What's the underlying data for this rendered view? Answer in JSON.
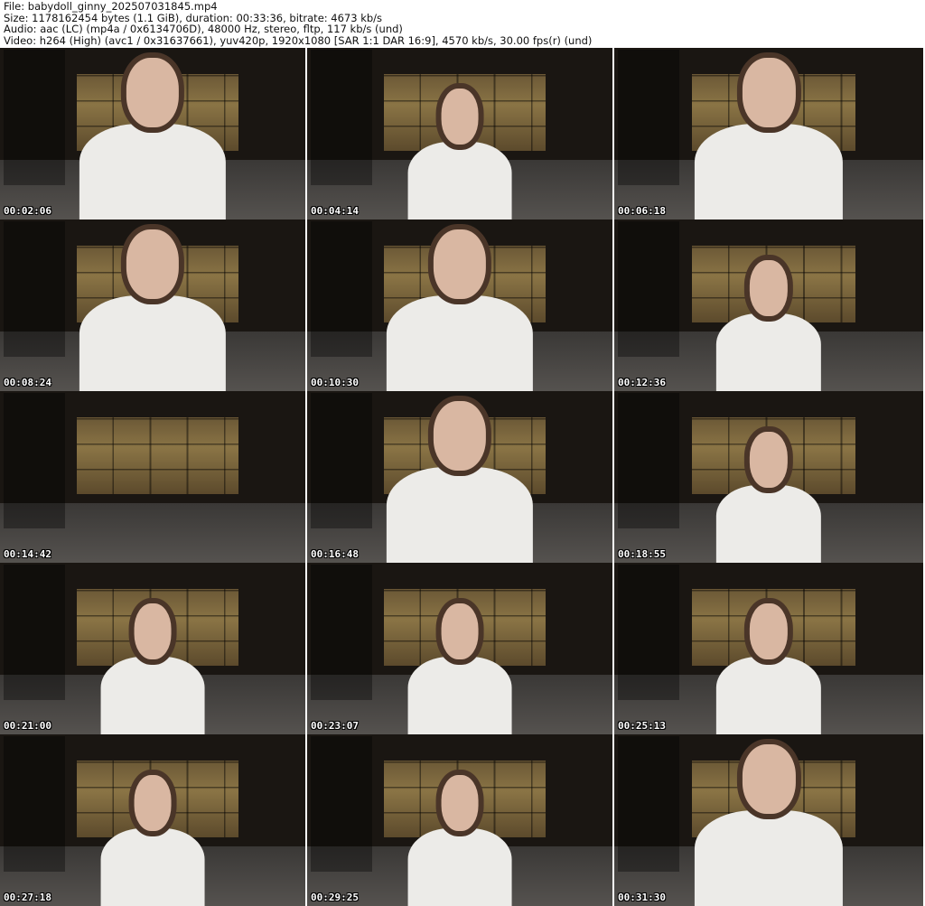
{
  "header": {
    "file": "File: babydoll_ginny_202507031845.mp4",
    "size": "Size: 1178162454 bytes (1.1 GiB), duration: 00:33:36, bitrate: 4673 kb/s",
    "audio": "Audio: aac (LC) (mp4a / 0x6134706D), 48000 Hz, stereo, fltp, 117 kb/s (und)",
    "video": "Video: h264 (High) (avc1 / 0x31637661), yuv420p, 1920x1080 [SAR 1:1 DAR 16:9], 4570 kb/s, 30.00 fps(r) (und)"
  },
  "thumbnails": [
    {
      "timestamp": "00:02:06"
    },
    {
      "timestamp": "00:04:14"
    },
    {
      "timestamp": "00:06:18"
    },
    {
      "timestamp": "00:08:24"
    },
    {
      "timestamp": "00:10:30"
    },
    {
      "timestamp": "00:12:36"
    },
    {
      "timestamp": "00:14:42"
    },
    {
      "timestamp": "00:16:48"
    },
    {
      "timestamp": "00:18:55"
    },
    {
      "timestamp": "00:21:00"
    },
    {
      "timestamp": "00:23:07"
    },
    {
      "timestamp": "00:25:13"
    },
    {
      "timestamp": "00:27:18"
    },
    {
      "timestamp": "00:29:25"
    },
    {
      "timestamp": "00:31:30"
    }
  ]
}
